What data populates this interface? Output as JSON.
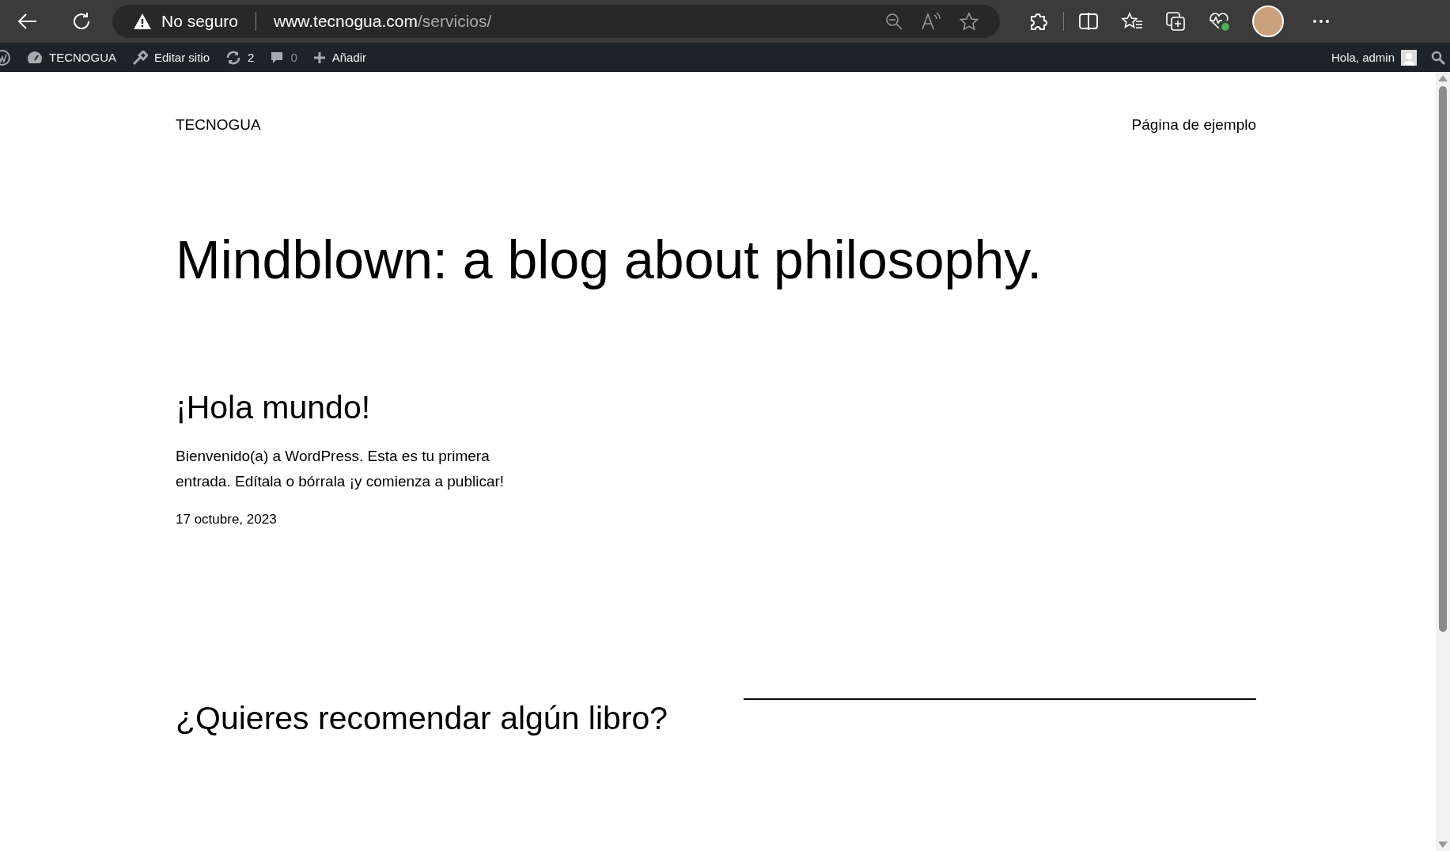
{
  "browser": {
    "security": "No seguro",
    "url_host": "www.tecnogua.com",
    "url_path": "/servicios/"
  },
  "admin_bar": {
    "site": "TECNOGUA",
    "edit": "Editar sitio",
    "updates": "2",
    "comments": "0",
    "add": "Añadir",
    "greeting": "Hola, admin"
  },
  "site": {
    "title": "TECNOGUA",
    "nav": [
      "Página de ejemplo"
    ]
  },
  "hero": {
    "heading": "Mindblown: a blog about philosophy."
  },
  "posts": [
    {
      "title": "¡Hola mundo!",
      "excerpt": "Bienvenido(a) a WordPress. Esta es tu primera entrada. Edítala o bórrala ¡y comienza a publicar!",
      "date": "17 octubre, 2023"
    }
  ],
  "cta": {
    "heading": "¿Quieres recomendar algún libro?"
  }
}
